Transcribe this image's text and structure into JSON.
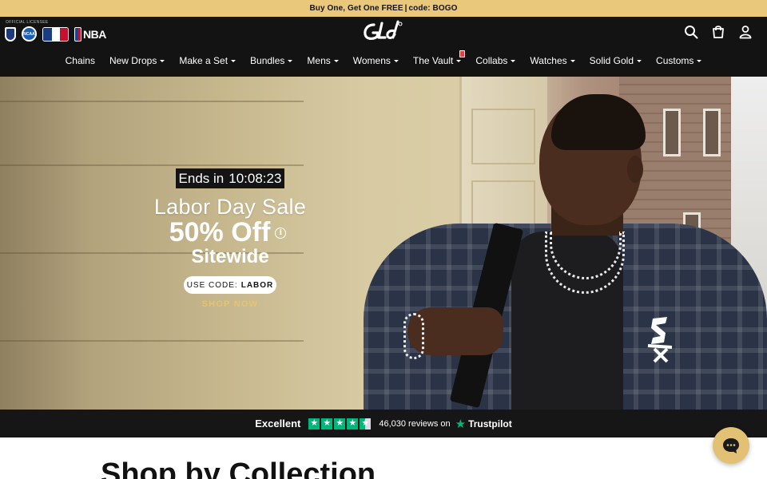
{
  "promo": {
    "text_before": "Buy One, Get One FREE",
    "separator": "|",
    "code_label": "code: BOGO"
  },
  "header": {
    "licensee_label": "OFFICIAL LICENSEE",
    "leagues": {
      "ncaa": "NCAA",
      "nba": "NBA"
    },
    "brand": "GLD",
    "icons": [
      "search-icon",
      "cart-icon",
      "account-icon"
    ]
  },
  "nav": {
    "items": [
      {
        "label": "Chains",
        "dropdown": false
      },
      {
        "label": "New Drops",
        "dropdown": true
      },
      {
        "label": "Make a Set",
        "dropdown": true
      },
      {
        "label": "Bundles",
        "dropdown": true
      },
      {
        "label": "Mens",
        "dropdown": true
      },
      {
        "label": "Womens",
        "dropdown": true
      },
      {
        "label": "The Vault",
        "dropdown": true
      },
      {
        "label": "Collabs",
        "dropdown": true
      },
      {
        "label": "Watches",
        "dropdown": true
      },
      {
        "label": "Solid Gold",
        "dropdown": true
      },
      {
        "label": "Customs",
        "dropdown": true
      }
    ]
  },
  "hero": {
    "countdown_label": "Ends in",
    "countdown_time": "10:08:23",
    "title": "Labor Day Sale",
    "discount": "50% Off",
    "info_glyph": "i",
    "subtitle": "Sitewide",
    "code_prefix": "USE CODE:",
    "code_value": "LABOR",
    "cta": "SHOP NOW",
    "colors": {
      "accent": "#e7c36b",
      "promo_bar": "#e9c87b",
      "dark": "#131313"
    }
  },
  "reviews": {
    "rating_word": "Excellent",
    "stars": 4.5,
    "count_text": "46,030 reviews on",
    "provider": "Trustpilot",
    "star_color": "#00b67a"
  },
  "section": {
    "title": "Shop by Collection"
  }
}
